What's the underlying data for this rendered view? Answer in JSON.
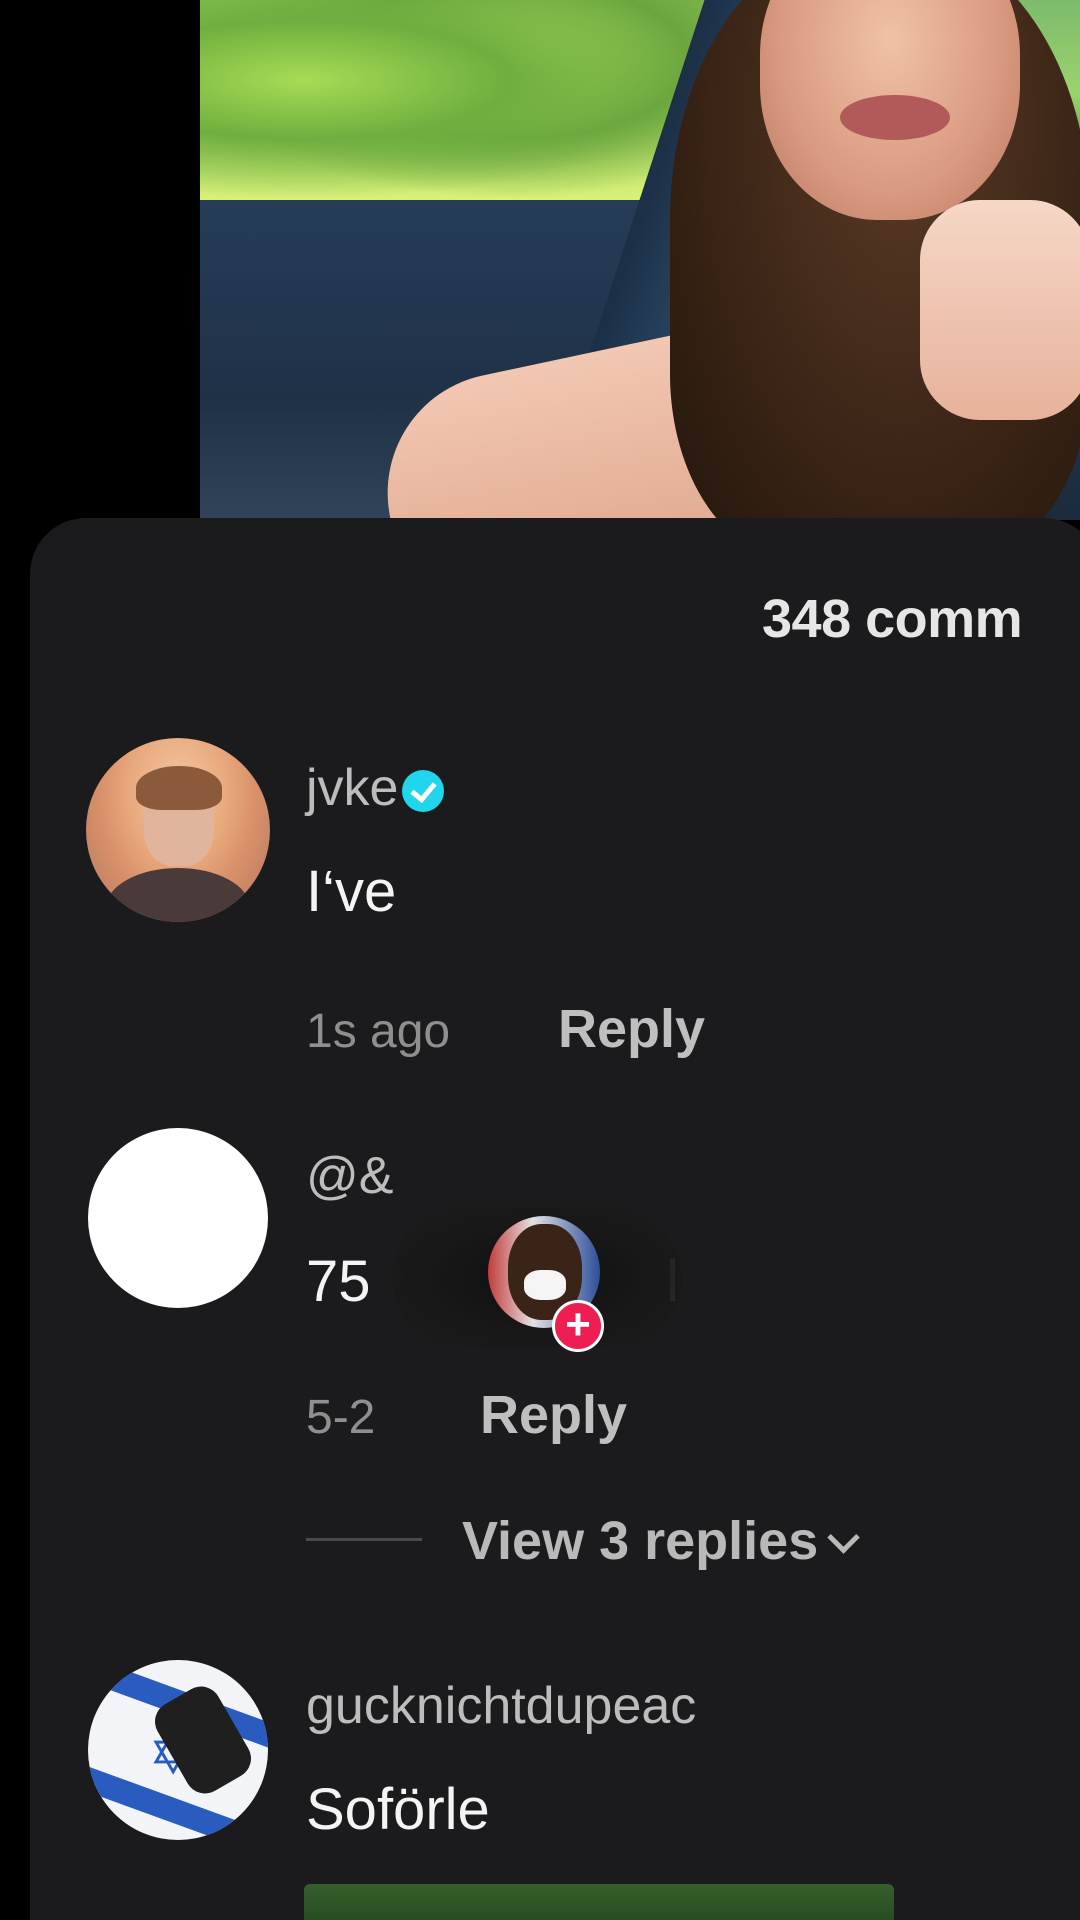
{
  "video": {
    "description_icon": "video-frame"
  },
  "comments_header": {
    "count_text": "348 comm"
  },
  "comments": [
    {
      "username": "jvke",
      "verified": true,
      "text": "I‘ve",
      "time": "1s ago",
      "reply_label": "Reply"
    },
    {
      "username": "@&",
      "verified": false,
      "text": "75",
      "text_tail": "l",
      "time": "5-2",
      "reply_label": "Reply",
      "view_replies_label": "View 3 replies"
    },
    {
      "username": "gucknichtdupeac",
      "verified": false,
      "text": "Soförle"
    }
  ],
  "overlay": {
    "follow_symbol": "+"
  },
  "colors": {
    "sheet_background": "#1b1b1d",
    "verified_badge": "#20d5ec",
    "follow_button": "#ee1d52"
  }
}
